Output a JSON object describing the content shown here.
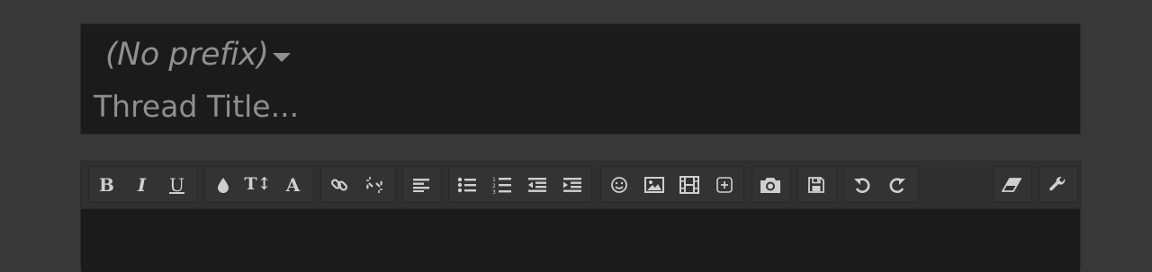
{
  "thread": {
    "prefix_label": "(No prefix)",
    "title_placeholder": "Thread Title..."
  },
  "toolbar": {
    "bold_label": "B",
    "italic_label": "I",
    "underline_label": "U",
    "font_size_label": "T↕",
    "font_family_label": "A"
  },
  "colors": {
    "page_bg": "#383838",
    "panel_bg": "#1b1b1b",
    "text_muted": "#8f8f8f",
    "icon": "#cfcfcf"
  }
}
